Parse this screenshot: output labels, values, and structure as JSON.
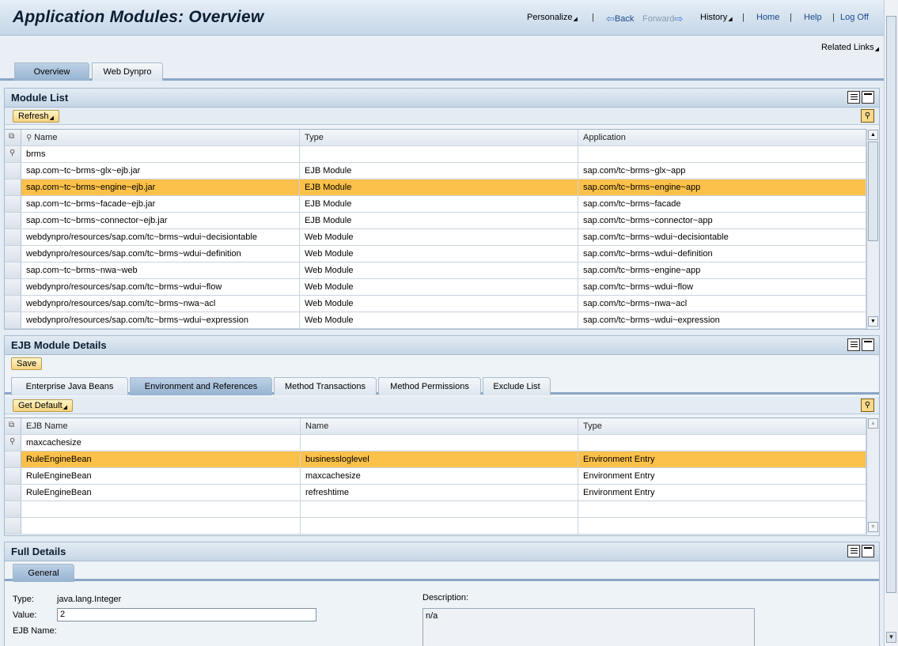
{
  "header": {
    "title": "Application Modules: Overview",
    "personalize": "Personalize",
    "back": "Back",
    "forward": "Forward",
    "history": "History",
    "home": "Home",
    "help": "Help",
    "logoff": "Log Off",
    "separator": "|"
  },
  "related_links": "Related Links",
  "top_tabs": [
    {
      "label": "Overview",
      "active": true
    },
    {
      "label": "Web Dynpro",
      "active": false
    }
  ],
  "module_list": {
    "title": "Module List",
    "refresh_label": "Refresh",
    "columns": [
      "Name",
      "Type",
      "Application"
    ],
    "filter_value": "brms",
    "rows": [
      {
        "name": "sap.com~tc~brms~glx~ejb.jar",
        "type": "EJB Module",
        "app": "sap.com/tc~brms~glx~app",
        "selected": false
      },
      {
        "name": "sap.com~tc~brms~engine~ejb.jar",
        "type": "EJB Module",
        "app": "sap.com/tc~brms~engine~app",
        "selected": true
      },
      {
        "name": "sap.com~tc~brms~facade~ejb.jar",
        "type": "EJB Module",
        "app": "sap.com/tc~brms~facade",
        "selected": false
      },
      {
        "name": "sap.com~tc~brms~connector~ejb.jar",
        "type": "EJB Module",
        "app": "sap.com/tc~brms~connector~app",
        "selected": false
      },
      {
        "name": "webdynpro/resources/sap.com/tc~brms~wdui~decisiontable",
        "type": "Web Module",
        "app": "sap.com/tc~brms~wdui~decisiontable",
        "selected": false
      },
      {
        "name": "webdynpro/resources/sap.com/tc~brms~wdui~definition",
        "type": "Web Module",
        "app": "sap.com/tc~brms~wdui~definition",
        "selected": false
      },
      {
        "name": "sap.com~tc~brms~nwa~web",
        "type": "Web Module",
        "app": "sap.com/tc~brms~engine~app",
        "selected": false
      },
      {
        "name": "webdynpro/resources/sap.com/tc~brms~wdui~flow",
        "type": "Web Module",
        "app": "sap.com/tc~brms~wdui~flow",
        "selected": false
      },
      {
        "name": "webdynpro/resources/sap.com/tc~brms~nwa~acl",
        "type": "Web Module",
        "app": "sap.com/tc~brms~nwa~acl",
        "selected": false
      },
      {
        "name": "webdynpro/resources/sap.com/tc~brms~wdui~expression",
        "type": "Web Module",
        "app": "sap.com/tc~brms~wdui~expression",
        "selected": false
      }
    ]
  },
  "ejb_details": {
    "title": "EJB Module Details",
    "save_label": "Save",
    "tabs": [
      {
        "label": "Enterprise Java Beans",
        "active": false
      },
      {
        "label": "Environment and References",
        "active": true
      },
      {
        "label": "Method Transactions",
        "active": false
      },
      {
        "label": "Method Permissions",
        "active": false
      },
      {
        "label": "Exclude List",
        "active": false
      }
    ],
    "get_default_label": "Get Default",
    "columns": [
      "EJB Name",
      "Name",
      "Type"
    ],
    "filter_value": "maxcachesize",
    "rows": [
      {
        "ejb": "RuleEngineBean",
        "name": "businessloglevel",
        "type": "Environment Entry",
        "selected": true
      },
      {
        "ejb": "RuleEngineBean",
        "name": "maxcachesize",
        "type": "Environment Entry",
        "selected": false
      },
      {
        "ejb": "RuleEngineBean",
        "name": "refreshtime",
        "type": "Environment Entry",
        "selected": false
      },
      {
        "ejb": "",
        "name": "",
        "type": "",
        "selected": false
      },
      {
        "ejb": "",
        "name": "",
        "type": "",
        "selected": false
      }
    ]
  },
  "full_details": {
    "title": "Full Details",
    "tab": "General",
    "type_label": "Type:",
    "type_value": "java.lang.Integer",
    "value_label": "Value:",
    "value_value": "2",
    "ejb_name_label": "EJB Name:",
    "description_label": "Description:",
    "description_value": "n/a"
  },
  "colors": {
    "selected_row": "#fcc14a",
    "header_bg": "#c4d6e8",
    "link": "#1a4a8a"
  }
}
